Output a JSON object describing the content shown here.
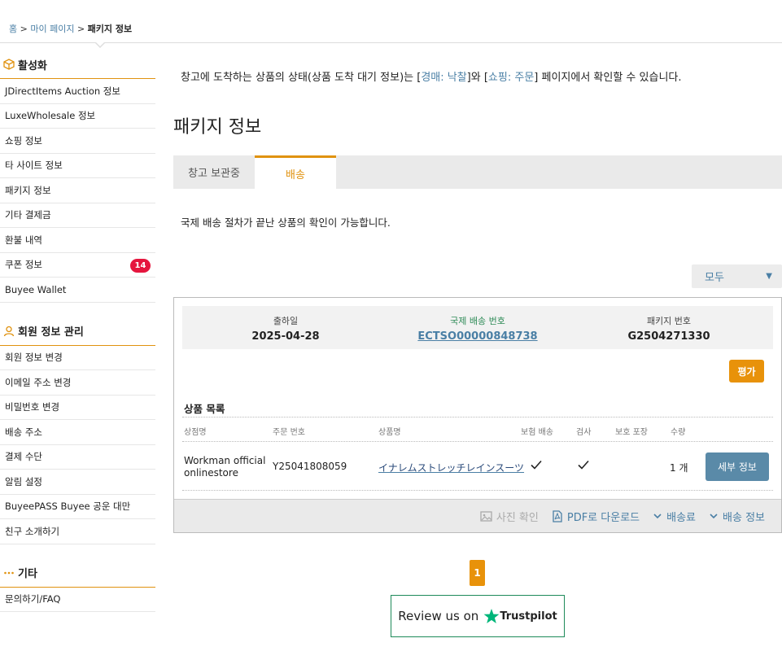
{
  "breadcrumb": {
    "home": "홈",
    "sep1": " > ",
    "mypage": "마이 페이지",
    "sep2": " > ",
    "current": "패키지 정보"
  },
  "sidebar": {
    "sections": [
      {
        "title": "활성화",
        "icon": "box-icon",
        "items": [
          {
            "label": "JDirectItems Auction 정보"
          },
          {
            "label": "LuxeWholesale 정보"
          },
          {
            "label": "쇼핑 정보"
          },
          {
            "label": "타 사이트 정보"
          },
          {
            "label": "패키지 정보"
          },
          {
            "label": "기타 결제금"
          },
          {
            "label": "환불 내역"
          },
          {
            "label": "쿠폰 정보",
            "badge": "14"
          },
          {
            "label": "Buyee Wallet"
          }
        ]
      },
      {
        "title": "회원 정보 관리",
        "icon": "user-icon",
        "items": [
          {
            "label": "회원 정보 변경"
          },
          {
            "label": "이메일 주소 변경"
          },
          {
            "label": "비밀번호 변경"
          },
          {
            "label": "배송 주소"
          },
          {
            "label": "결제 수단"
          },
          {
            "label": "알림 설정"
          },
          {
            "label": "BuyeePASS Buyee 공운 대만"
          },
          {
            "label": "친구 소개하기"
          }
        ]
      },
      {
        "title": "기타",
        "icon": "more-icon",
        "items": [
          {
            "label": "문의하기/FAQ"
          }
        ]
      }
    ]
  },
  "intro": {
    "prefix": "창고에 도착하는 상품의 상태(상품 도착 대기 정보)는 [",
    "link1": "경매: 낙찰",
    "mid": "]와 [",
    "link2": "쇼핑: 주문",
    "suffix": "] 페이지에서 확인할 수 있습니다."
  },
  "page_title": "패키지 정보",
  "tabs": [
    {
      "label": "창고 보관중"
    },
    {
      "label": "배송"
    }
  ],
  "description": "국제 배송 절차가 끝난 상품의 확인이 가능합니다.",
  "filter": {
    "value": "모두",
    "arrow": "▼"
  },
  "package": {
    "ship_date_label": "출하일",
    "ship_date": "2025-04-28",
    "tracking_label": "국제 배송 번호",
    "tracking_number": "ECTSO00000848738",
    "package_label": "패키지 번호",
    "package_number": "G2504271330",
    "rate_button": "평가",
    "list_title": "상품 목록",
    "columns": [
      "상점명",
      "주문 번호",
      "상품명",
      "보험 배송",
      "검사",
      "보호 포장",
      "수량"
    ],
    "row": {
      "store_line1": "Workman official",
      "store_line2": "onlinestore",
      "order_no": "Y25041808059",
      "item_name": "イナレムストレッチレインスーツ",
      "insurance": true,
      "inspection": true,
      "qty": "1 개"
    },
    "detail_button": "세부 정보",
    "footer": {
      "photo": "사진 확인",
      "pdf": "PDF로 다운로드",
      "fee": "배송료",
      "shipping_info": "배송 정보"
    }
  },
  "pagination": {
    "current": "1"
  },
  "trustpilot": {
    "text": "Review us on",
    "brand": "Trustpilot",
    "star_color": "#00b67a"
  },
  "colors": {
    "accent": "#e8920a",
    "link": "#4a7fa5",
    "badge": "#e5163e",
    "detail_button": "#5a8aa8"
  }
}
